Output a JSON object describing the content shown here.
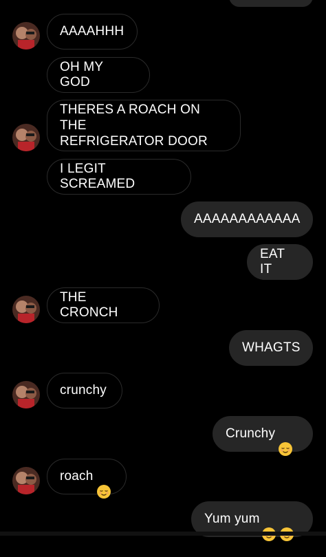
{
  "messages": {
    "m1": "AAAAHHH",
    "m2": "OH MY GOD",
    "m3": "THERES A ROACH ON THE\nREFRIGERATOR DOOR",
    "m4": "I LEGIT SCREAMED",
    "m5": "AAAAAAAAAAAA",
    "m6": "EAT IT",
    "m7": "THE CRONCH",
    "m8": "WHAGTS",
    "m9": "crunchy",
    "m10": "Crunchy",
    "m11": "roach",
    "m12": "Yum yum"
  },
  "icons": {
    "emoji": "relieved-face-emoji",
    "avatar": "contact-avatar"
  },
  "colors": {
    "background": "#000000",
    "incoming_border": "#2b2b2b",
    "outgoing_fill": "#262626",
    "text": "#ffffff"
  }
}
